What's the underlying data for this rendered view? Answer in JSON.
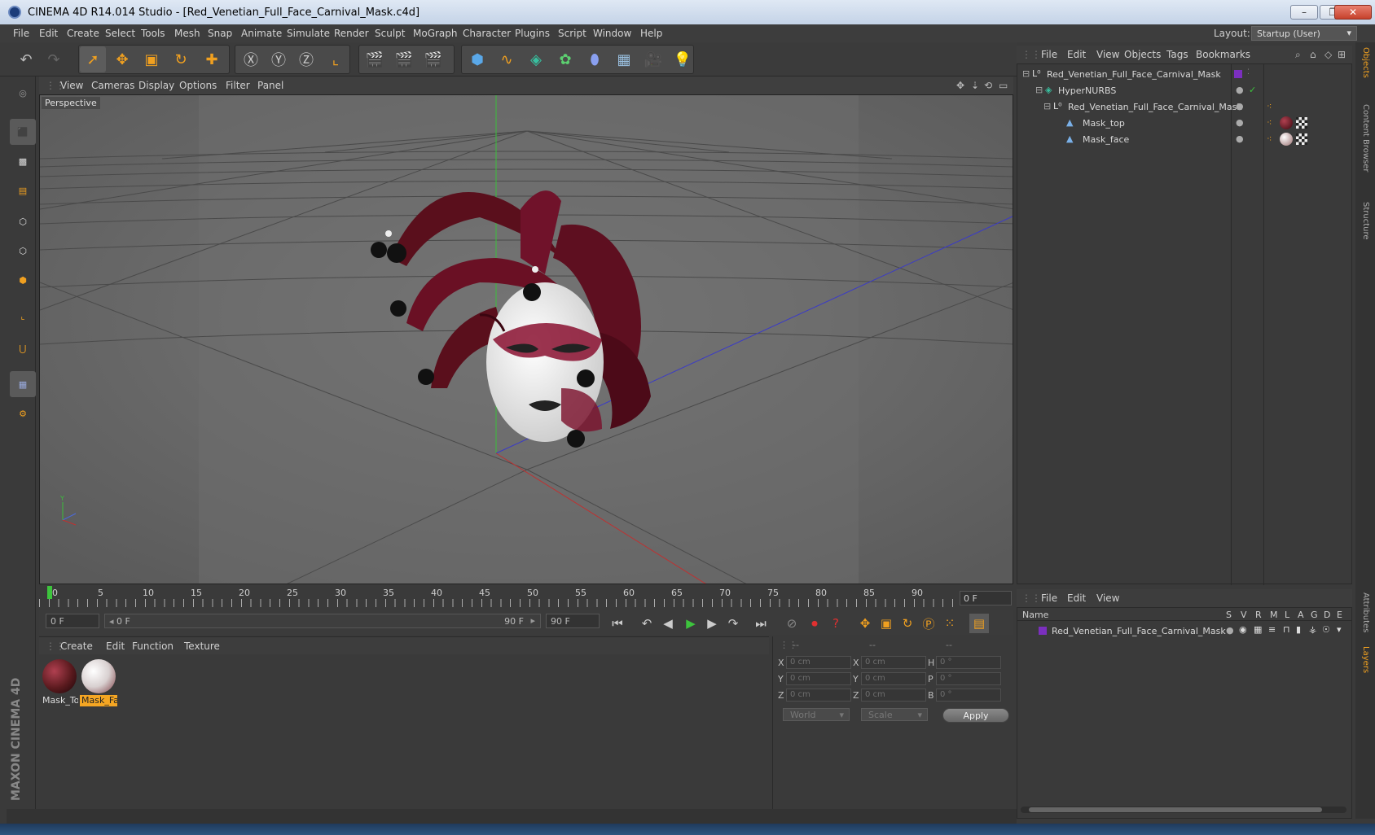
{
  "window": {
    "title": "CINEMA 4D R14.014 Studio - [Red_Venetian_Full_Face_Carnival_Mask.c4d]"
  },
  "menubar": {
    "items": [
      "File",
      "Edit",
      "Create",
      "Select",
      "Tools",
      "Mesh",
      "Snap",
      "Animate",
      "Simulate",
      "Render",
      "Sculpt",
      "MoGraph",
      "Character",
      "Plugins",
      "Script",
      "Window",
      "Help"
    ],
    "layout_label": "Layout:",
    "layout_value": "Startup (User)"
  },
  "viewport": {
    "menu": [
      "View",
      "Cameras",
      "Display",
      "Options",
      "Filter",
      "Panel"
    ],
    "camera_label": "Perspective"
  },
  "timeline": {
    "ticks": [
      "0",
      "5",
      "10",
      "15",
      "20",
      "25",
      "30",
      "35",
      "40",
      "45",
      "50",
      "55",
      "60",
      "65",
      "70",
      "75",
      "80",
      "85",
      "90"
    ],
    "current_frame": "0 F"
  },
  "transport": {
    "start_field": "0 F",
    "range_start": "0 F",
    "range_end": "90 F",
    "end_field": "90 F"
  },
  "materials": {
    "menu": [
      "Create",
      "Edit",
      "Function",
      "Texture"
    ],
    "items": [
      {
        "label": "Mask_To",
        "selected": false,
        "color": "#5a1a1e"
      },
      {
        "label": "Mask_Fa",
        "selected": true,
        "color": "#d8d0d0"
      }
    ]
  },
  "coordinates": {
    "headers": [
      "--",
      "--",
      "--"
    ],
    "rows": [
      {
        "a": "X",
        "av": "0 cm",
        "b": "X",
        "bv": "0 cm",
        "c": "H",
        "cv": "0 °"
      },
      {
        "a": "Y",
        "av": "0 cm",
        "b": "Y",
        "bv": "0 cm",
        "c": "P",
        "cv": "0 °"
      },
      {
        "a": "Z",
        "av": "0 cm",
        "b": "Z",
        "bv": "0 cm",
        "c": "B",
        "cv": "0 °"
      }
    ],
    "mode": "World",
    "scale": "Scale",
    "apply": "Apply"
  },
  "object_manager": {
    "menu": [
      "File",
      "Edit",
      "View",
      "Objects",
      "Tags",
      "Bookmarks"
    ],
    "objects": [
      {
        "name": "Red_Venetian_Full_Face_Carnival_Mask",
        "indent": 0
      },
      {
        "name": "HyperNURBS",
        "indent": 1
      },
      {
        "name": "Red_Venetian_Full_Face_Carnival_Mask",
        "indent": 2
      },
      {
        "name": "Mask_top",
        "indent": 3
      },
      {
        "name": "Mask_face",
        "indent": 3
      }
    ]
  },
  "side_tabs": [
    "Objects",
    "Content Browser",
    "Structure",
    "Attributes",
    "Layers"
  ],
  "layers": {
    "menu": [
      "File",
      "Edit",
      "View"
    ],
    "columns": [
      "Name",
      "S",
      "V",
      "R",
      "M",
      "L",
      "A",
      "G",
      "D",
      "E"
    ],
    "items": [
      "Red_Venetian_Full_Face_Carnival_Mask"
    ]
  },
  "branding": "MAXON CINEMA 4D",
  "colors": {
    "accent": "#f0a020",
    "selection": "#f5a623",
    "layer_color": "#7b2fbe"
  }
}
